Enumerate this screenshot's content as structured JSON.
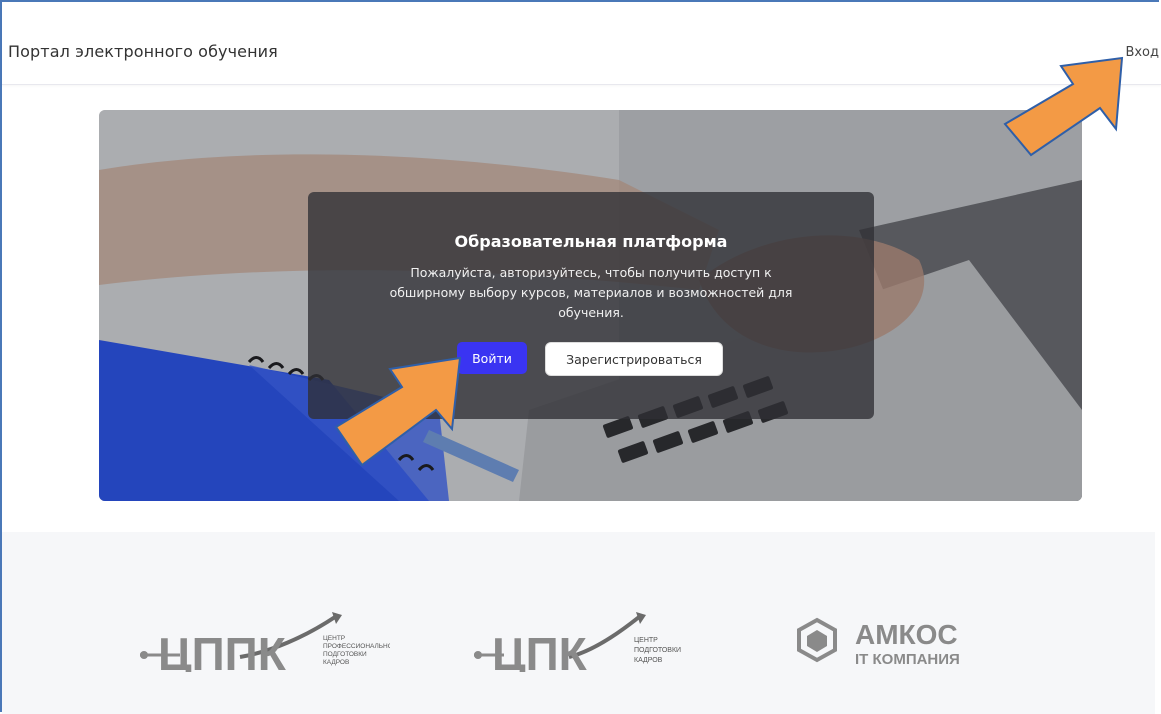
{
  "header": {
    "title": "Портал электронного обучения",
    "login_link": "Вход"
  },
  "hero": {
    "title": "Образовательная платформа",
    "description": "Пожалуйста, авторизуйтесь, чтобы получить доступ к обширному выбору курсов, материалов и возможностей для обучения.",
    "login_button": "Войти",
    "register_button": "Зарегистрироваться"
  },
  "partners": [
    {
      "logo_text": "ЦППК",
      "caption_lines": [
        "ЦЕНТР",
        "ПРОФЕССИОНАЛЬНОЙ",
        "ПОДГОТОВКИ",
        "КАДРОВ"
      ]
    },
    {
      "logo_text": "ЦПК",
      "caption_lines": [
        "ЦЕНТР",
        "ПОДГОТОВКИ",
        "КАДРОВ"
      ]
    },
    {
      "logo_text": "АМКОС",
      "subtitle": "IT КОМПАНИЯ"
    }
  ],
  "colors": {
    "primary_button": "#3a34f2",
    "arrow": "#f39a45",
    "arrow_outline": "#2f5fa8",
    "logo_gray": "#8a8a8a"
  }
}
